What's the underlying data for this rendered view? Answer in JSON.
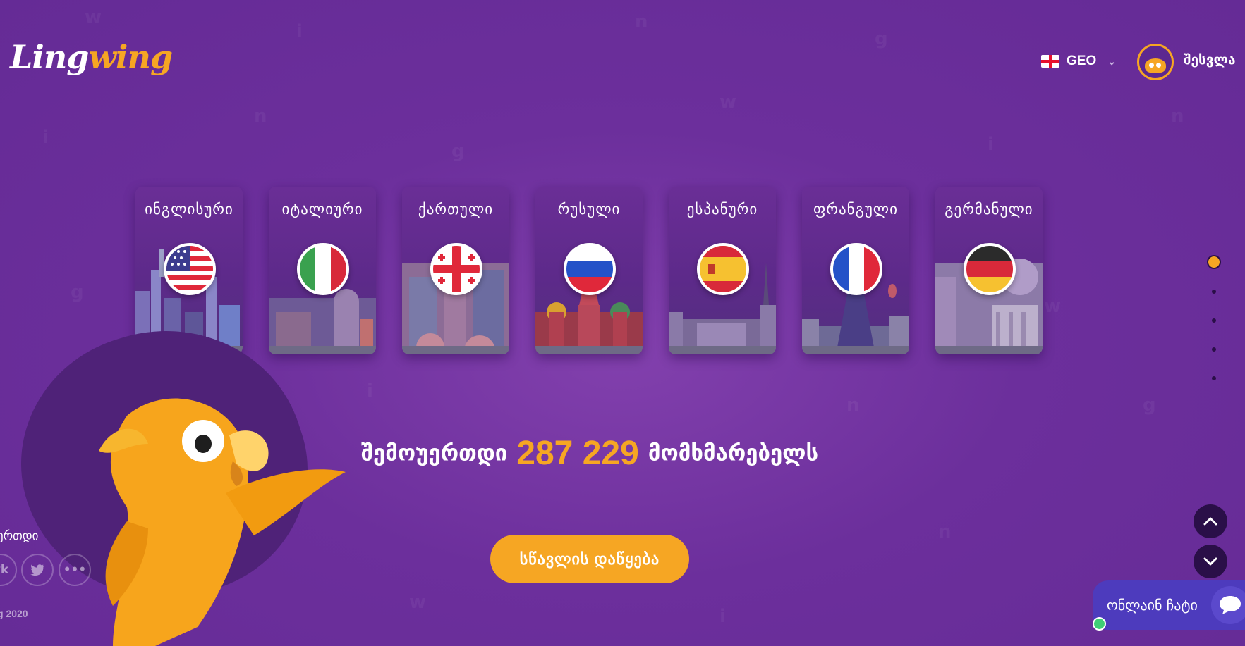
{
  "header": {
    "logo": {
      "part1": "Ling",
      "part2": "wing"
    },
    "language": {
      "code": "GEO",
      "flag_icon": "georgia-flag-icon"
    },
    "login_label": "შესვლა"
  },
  "languages": [
    {
      "title": "ინგლისური",
      "flag": "usa"
    },
    {
      "title": "იტალიური",
      "flag": "italy"
    },
    {
      "title": "ქართული",
      "flag": "georgia"
    },
    {
      "title": "რუსული",
      "flag": "russia"
    },
    {
      "title": "ესპანური",
      "flag": "spain"
    },
    {
      "title": "ფრანგული",
      "flag": "france"
    },
    {
      "title": "გერმანული",
      "flag": "germany"
    }
  ],
  "main": {
    "join_prefix": "შემოუერთდი",
    "user_count": "287 229",
    "join_suffix": "მომხმარებელს",
    "start_button": "სწავლის დაწყება"
  },
  "sidebar": {
    "join_us": "ერთდი",
    "copyright": "g 2020",
    "social_icons": [
      "vk-icon",
      "twitter-icon",
      "more-icon"
    ]
  },
  "pagination": {
    "count": 5,
    "active_index": 0
  },
  "chat": {
    "label": "ონლაინ ჩატი",
    "status": "online"
  },
  "colors": {
    "background": "#6c2f9c",
    "accent": "#f6a623",
    "dark": "#2a0f48",
    "chat": "#4d3bbd",
    "online": "#3fce76"
  }
}
